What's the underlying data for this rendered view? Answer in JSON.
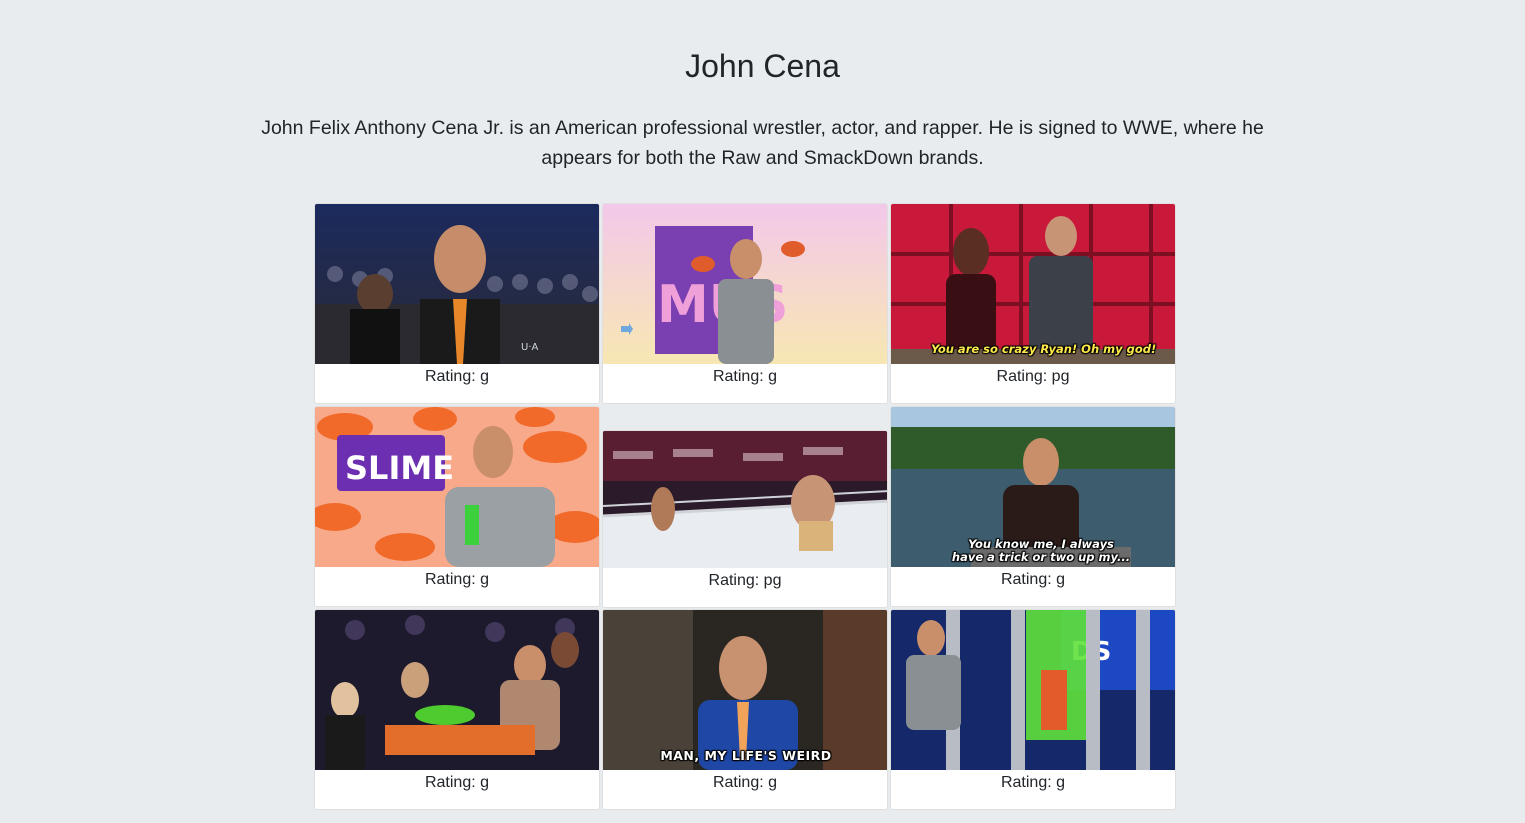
{
  "page": {
    "title": "John Cena",
    "description": "John Felix Anthony Cena Jr. is an American professional wrestler, actor, and rapper. He is signed to WWE, where he appears for both the Raw and SmackDown brands."
  },
  "colors": {
    "background": "#e9ecef",
    "card": "#ffffff",
    "text": "#212529"
  },
  "gifs": [
    {
      "rating_text": "Rating: g",
      "caption": "",
      "scene": "crowd-arena"
    },
    {
      "rating_text": "Rating: g",
      "caption": "",
      "scene": "pastel-must",
      "sign": "MUS"
    },
    {
      "rating_text": "Rating: pg",
      "caption": "You are so crazy Ryan! Oh my god!",
      "scene": "red-stage"
    },
    {
      "rating_text": "Rating: g",
      "caption": "",
      "scene": "slime-orange",
      "sign": "SLIME"
    },
    {
      "rating_text": "Rating: pg",
      "caption": "",
      "scene": "wrestling-ring"
    },
    {
      "rating_text": "Rating: g",
      "caption": "You know me, I always have a trick or two up my...",
      "scene": "lake"
    },
    {
      "rating_text": "Rating: g",
      "caption": "",
      "scene": "arm-wrestle"
    },
    {
      "rating_text": "Rating: g",
      "caption": "MAN, MY LIFE'S WEIRD",
      "scene": "blue-suit"
    },
    {
      "rating_text": "Rating: g",
      "caption": "",
      "scene": "green-slime",
      "sign": "DS"
    }
  ]
}
